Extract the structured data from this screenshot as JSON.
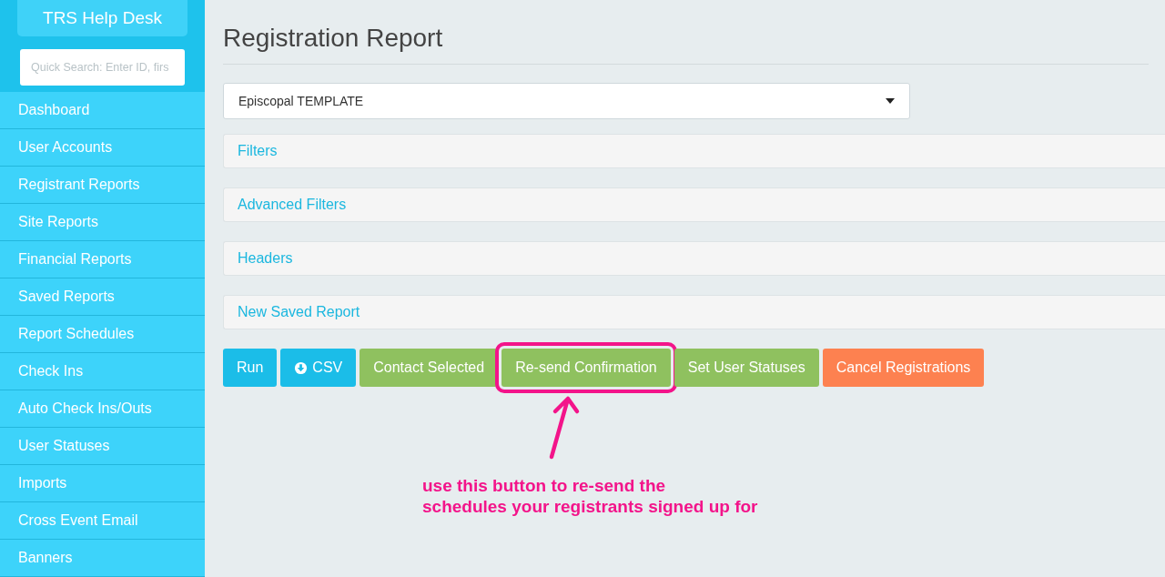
{
  "sidebar": {
    "title": "TRS Help Desk",
    "search": {
      "placeholder": "Quick Search: Enter ID, firs"
    },
    "items": [
      {
        "label": "Dashboard"
      },
      {
        "label": "User Accounts"
      },
      {
        "label": "Registrant Reports"
      },
      {
        "label": "Site Reports"
      },
      {
        "label": "Financial Reports"
      },
      {
        "label": "Saved Reports"
      },
      {
        "label": "Report Schedules"
      },
      {
        "label": "Check Ins"
      },
      {
        "label": "Auto Check Ins/Outs"
      },
      {
        "label": "User Statuses"
      },
      {
        "label": "Imports"
      },
      {
        "label": "Cross Event Email"
      },
      {
        "label": "Banners"
      }
    ]
  },
  "page": {
    "title": "Registration Report",
    "select": {
      "value": "Episcopal TEMPLATE"
    },
    "panels": [
      "Filters",
      "Advanced Filters",
      "Headers",
      "New Saved Report"
    ],
    "buttons": [
      {
        "label": "Run",
        "kind": "primary",
        "icon": false,
        "highlighted": false
      },
      {
        "label": "CSV",
        "kind": "primary",
        "icon": true,
        "highlighted": false
      },
      {
        "label": "Contact Selected",
        "kind": "success",
        "icon": false,
        "highlighted": false
      },
      {
        "label": "Re-send Confirmation",
        "kind": "success",
        "icon": false,
        "highlighted": true
      },
      {
        "label": "Set User Statuses",
        "kind": "success",
        "icon": false,
        "highlighted": false
      },
      {
        "label": "Cancel Registrations",
        "kind": "danger",
        "icon": false,
        "highlighted": false
      }
    ]
  },
  "annotation": {
    "text": "use this button to re-send the\nschedules your registrants signed up for"
  }
}
